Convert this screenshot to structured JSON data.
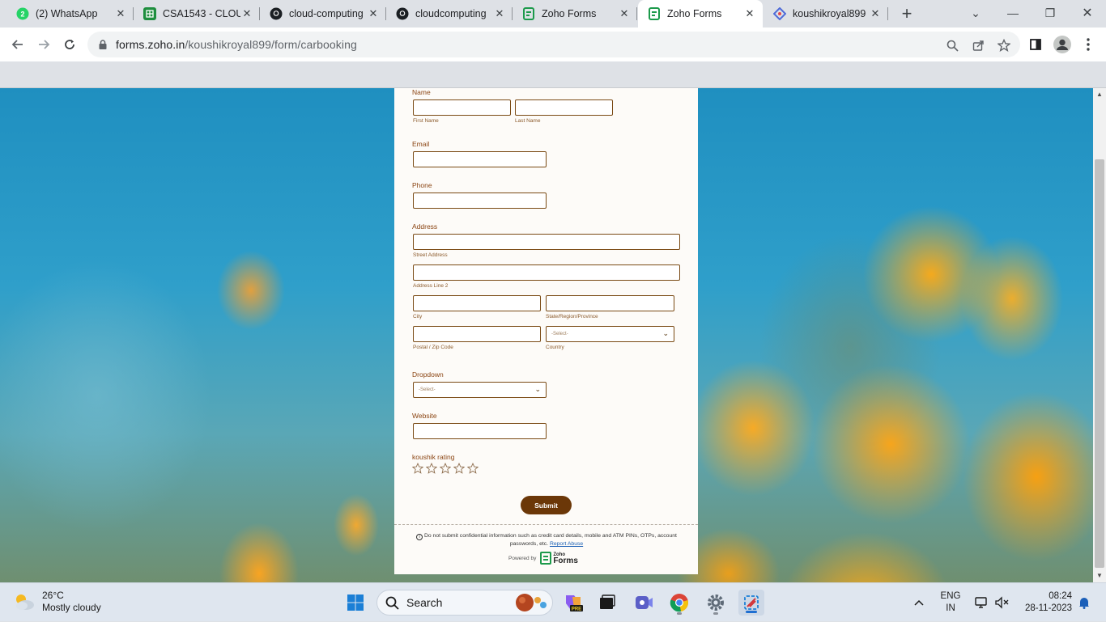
{
  "browser": {
    "tabs": [
      {
        "title": "(2) WhatsApp",
        "icon": "whatsapp-icon"
      },
      {
        "title": "CSA1543 - CLOU",
        "icon": "sheets-icon"
      },
      {
        "title": "cloud-computing",
        "icon": "github-icon"
      },
      {
        "title": "cloudcomputing",
        "icon": "github-icon"
      },
      {
        "title": "Zoho Forms",
        "icon": "zoho-forms-icon"
      },
      {
        "title": "Zoho Forms",
        "icon": "zoho-forms-icon",
        "active": true
      },
      {
        "title": "koushikroyal899",
        "icon": "zoho-creator-icon"
      }
    ],
    "url_host": "forms.zoho.in",
    "url_path": "/koushikroyal899/form/carbooking"
  },
  "form": {
    "name_label": "Name",
    "first_name_sub": "First Name",
    "last_name_sub": "Last Name",
    "email_label": "Email",
    "phone_label": "Phone",
    "address_label": "Address",
    "street_sub": "Street Address",
    "line2_sub": "Address Line 2",
    "city_sub": "City",
    "state_sub": "State/Region/Province",
    "zip_sub": "Postal / Zip Code",
    "country_sub": "Country",
    "country_select": "-Select-",
    "dropdown_label": "Dropdown",
    "dropdown_select": "-Select-",
    "website_label": "Website",
    "rating_label": "koushik rating",
    "rating_value": 0,
    "rating_max": 5,
    "submit_label": "Submit",
    "disclaimer": "Do not submit confidential information such as credit card details, mobile and ATM PINs, OTPs, account passwords, etc.",
    "report_abuse": "Report Abuse",
    "powered_by": "Powered by",
    "logo_line1": "Zoho",
    "logo_line2": "Forms",
    "accent_color": "#6b3708"
  },
  "taskbar": {
    "weather_temp": "26°C",
    "weather_desc": "Mostly cloudy",
    "search_placeholder": "Search",
    "lang_line1": "ENG",
    "lang_line2": "IN",
    "time": "08:24",
    "date": "28-11-2023"
  }
}
